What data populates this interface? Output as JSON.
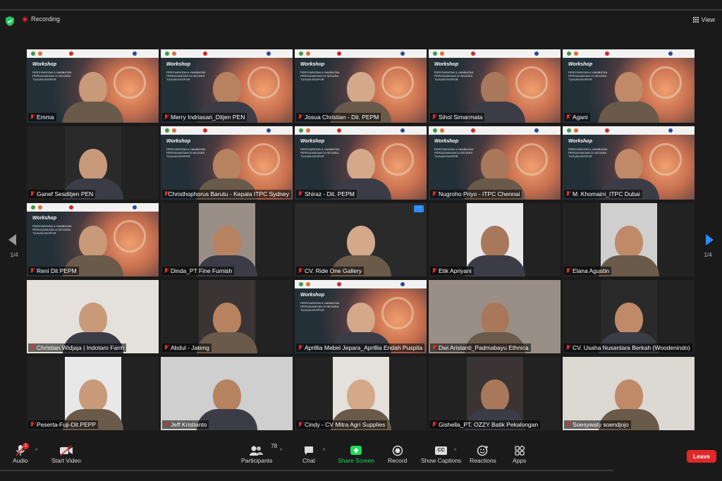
{
  "top": {
    "recording_label": "Recording",
    "view_label": "View"
  },
  "pager": {
    "left": "1/4",
    "right": "1/4"
  },
  "slide": {
    "title": "Workshop",
    "subtitle": "PERSYARATAN & HAMBATAN PERDAGANGAN DI NEGARA TUJUAN EKSPOR"
  },
  "participants": [
    {
      "name": "Emma",
      "kind": "slide"
    },
    {
      "name": "Merry Indriasari_Ditjen PEN",
      "kind": "slide"
    },
    {
      "name": "Josua Christian - Dit. PEPM",
      "kind": "slide"
    },
    {
      "name": "Sihol Simarmata",
      "kind": "slide"
    },
    {
      "name": "Agani",
      "kind": "slide"
    },
    {
      "name": "Ganef Sesditjen PEN",
      "kind": "cam"
    },
    {
      "name": "Christhophorus Barutu - Kepala ITPC Sydney",
      "kind": "slide"
    },
    {
      "name": "Shiraz - Dit. PEPM",
      "kind": "slide",
      "active": true
    },
    {
      "name": "Nugroho Priyo - ITPC Chennai",
      "kind": "slide"
    },
    {
      "name": "M. Khomaini_ITPC Dubai",
      "kind": "slide"
    },
    {
      "name": "Reni Dit PEPM",
      "kind": "slide"
    },
    {
      "name": "Dinda_PT Fine Furnish",
      "kind": "cam"
    },
    {
      "name": "CV. Ride One Gallery",
      "kind": "cam",
      "more": true
    },
    {
      "name": "Etik Apriyani",
      "kind": "cam"
    },
    {
      "name": "Elana Agustin",
      "kind": "cam"
    },
    {
      "name": "Christian Widjaja | Indotaro Farm",
      "kind": "cam"
    },
    {
      "name": "Abdul - Jateng",
      "kind": "cam"
    },
    {
      "name": "Aprillia Mebel Jepara_Aprillia Endah Puspita",
      "kind": "slide"
    },
    {
      "name": "Dwi Aristanti_Padmabayu Ethnica",
      "kind": "cam"
    },
    {
      "name": "CV. Usaha Nusantara Berkah (Woodenindo)",
      "kind": "cam"
    },
    {
      "name": "Peserta-Fuji-Dit.PEPP",
      "kind": "cam"
    },
    {
      "name": "Jeff Kristianto",
      "kind": "cam"
    },
    {
      "name": "Cindy - CV Mitra Agri Supplies",
      "kind": "cam"
    },
    {
      "name": "Gishella_PT. OZZY Batik Pekalongan",
      "kind": "cam"
    },
    {
      "name": "Soesywaty soendjojo",
      "kind": "cam"
    }
  ],
  "more_label": "···",
  "toolbar": {
    "audio": "Audio",
    "audio_badge": "1",
    "video": "Start Video",
    "participants": "Participants",
    "participants_count": "78",
    "chat": "Chat",
    "share": "Share Screen",
    "record": "Record",
    "captions": "Show Captions",
    "captions_badge": "CC",
    "reactions": "Reactions",
    "apps": "Apps",
    "leave": "Leave"
  },
  "colors": {
    "accent_blue": "#2d8cff",
    "leave_red": "#e02828",
    "share_green": "#23d959",
    "active_border": "#e5e03a"
  }
}
